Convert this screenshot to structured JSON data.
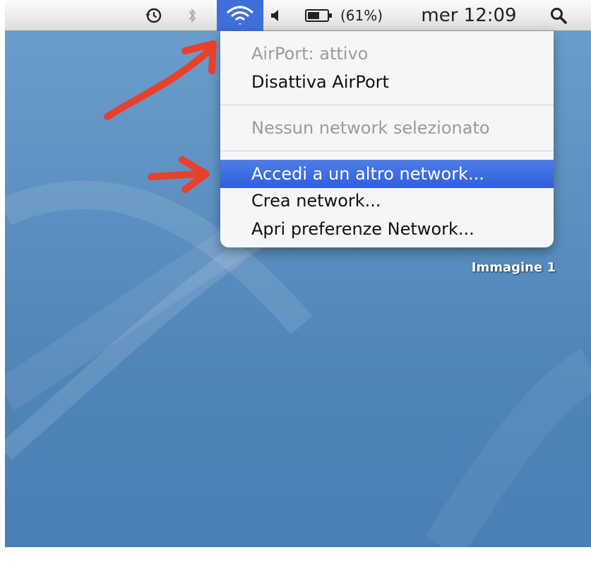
{
  "menubar": {
    "battery_percent": "(61%)",
    "clock": "mer 12:09",
    "icons": [
      "time-machine-icon",
      "bluetooth-icon",
      "airport-wifi-icon",
      "volume-icon",
      "battery-icon",
      "spotlight-icon"
    ]
  },
  "airport_menu": {
    "status": "AirPort: attivo",
    "toggle": "Disattiva AirPort",
    "no_network": "Nessun network selezionato",
    "join_other": "Accedi a un altro network...",
    "create": "Crea network...",
    "open_prefs": "Apri preferenze Network..."
  },
  "desktop": {
    "file_label": "Immagine 1"
  },
  "colors": {
    "accent": "#3f6fd8",
    "highlight": "#2d5fdb",
    "annotation": "#e8402a",
    "desktop": "#5c8fc0"
  }
}
